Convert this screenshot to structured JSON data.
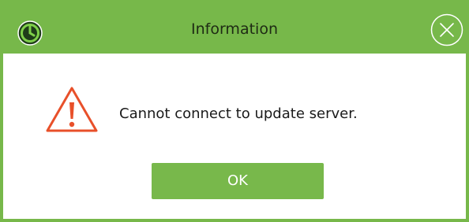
{
  "dialog": {
    "title": "Information",
    "message": "Cannot connect to update server.",
    "ok_label": "OK"
  },
  "icons": {
    "app": "app-logo-icon",
    "close": "close-icon",
    "warning": "warning-triangle-icon"
  },
  "colors": {
    "accent": "#77b84a",
    "warning": "#e8502a",
    "title_text": "#1e2a14"
  }
}
